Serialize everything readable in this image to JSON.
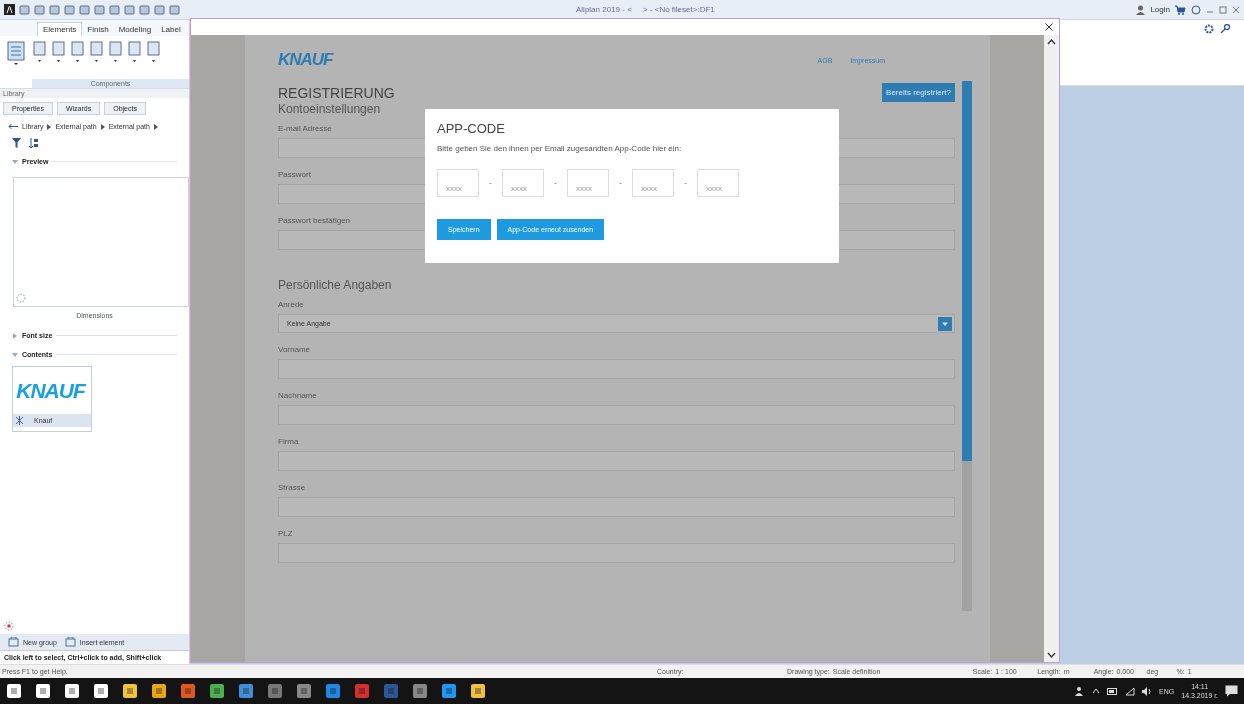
{
  "title_bar": {
    "title": "Allplan 2019 - <     > - <No fileset>:DF1",
    "login": "Login"
  },
  "ribbon": {
    "tabs": [
      {
        "label": "Elements",
        "selected": true
      },
      {
        "label": "Finish",
        "selected": false
      },
      {
        "label": "Modeling",
        "selected": false
      },
      {
        "label": "Label",
        "selected": false
      }
    ],
    "group_label": "Components"
  },
  "library": {
    "title": "Library",
    "tabs": [
      {
        "label": "Properties"
      },
      {
        "label": "Wizards"
      },
      {
        "label": "Objects"
      }
    ],
    "breadcrumb": [
      "Library",
      "External path",
      "External path"
    ],
    "preview": {
      "label": "Preview",
      "expanded": true,
      "caption": "Dimensions"
    },
    "font_size": {
      "label": "Font size",
      "expanded": false
    },
    "contents": {
      "label": "Contents",
      "expanded": true,
      "items": [
        {
          "logo": "KNAUF",
          "name": "Knauf"
        }
      ]
    },
    "actions": [
      "New group",
      "Insert element"
    ],
    "hint": "Click left to select, Ctrl+click to add, Shift+click"
  },
  "browser_dialog": {
    "page": {
      "logo": "KNAUF",
      "links": [
        "AGB",
        "Impressum"
      ],
      "login_button": "Bereits registriert?",
      "title": "REGISTRIERUNG",
      "sections": [
        {
          "heading": "Kontoeinstellungen",
          "fields": [
            {
              "label": "E-mail Adresse",
              "kind": "text"
            },
            {
              "label": "Passwort",
              "kind": "text"
            },
            {
              "label": "Passwort bestätigen",
              "kind": "text"
            }
          ]
        },
        {
          "heading": "Persönliche Angaben",
          "fields": [
            {
              "label": "Anrede",
              "kind": "select",
              "value": "Keine Angabe"
            },
            {
              "label": "Vorname",
              "kind": "text"
            },
            {
              "label": "Nachname",
              "kind": "text"
            },
            {
              "label": "Firma",
              "kind": "text"
            },
            {
              "label": "Strasse",
              "kind": "text"
            },
            {
              "label": "PLZ",
              "kind": "text"
            }
          ]
        }
      ]
    },
    "modal": {
      "title": "APP-CODE",
      "text": "Bitte geben Sie den ihnen per Email zugesandten App-Code hier ein:",
      "code_fields": [
        {
          "placeholder": "xxxx",
          "separator": "-"
        },
        {
          "placeholder": "xxxx",
          "separator": "-"
        },
        {
          "placeholder": "xxxx",
          "separator": "-"
        },
        {
          "placeholder": "xxxx",
          "separator": "-"
        },
        {
          "placeholder": "xxxx"
        }
      ],
      "buttons": [
        "Speichern",
        "App-Code erneut zusenden"
      ]
    }
  },
  "status_bar": {
    "help": "Press F1 to get Help.",
    "country": "Country:",
    "drawing_type_label": "Drawing type:",
    "drawing_type": "Scale definition",
    "scale_label": "Scale:",
    "scale": "1 : 100",
    "length_label": "Length:",
    "length": "m",
    "angle_label": "Angle:",
    "angle": "0.000",
    "angle_unit": "deg",
    "percent_label": "%:",
    "percent": "1"
  },
  "taskbar": {
    "language": "ENG",
    "time": "14:11",
    "date": "14.3.2019 г."
  }
}
